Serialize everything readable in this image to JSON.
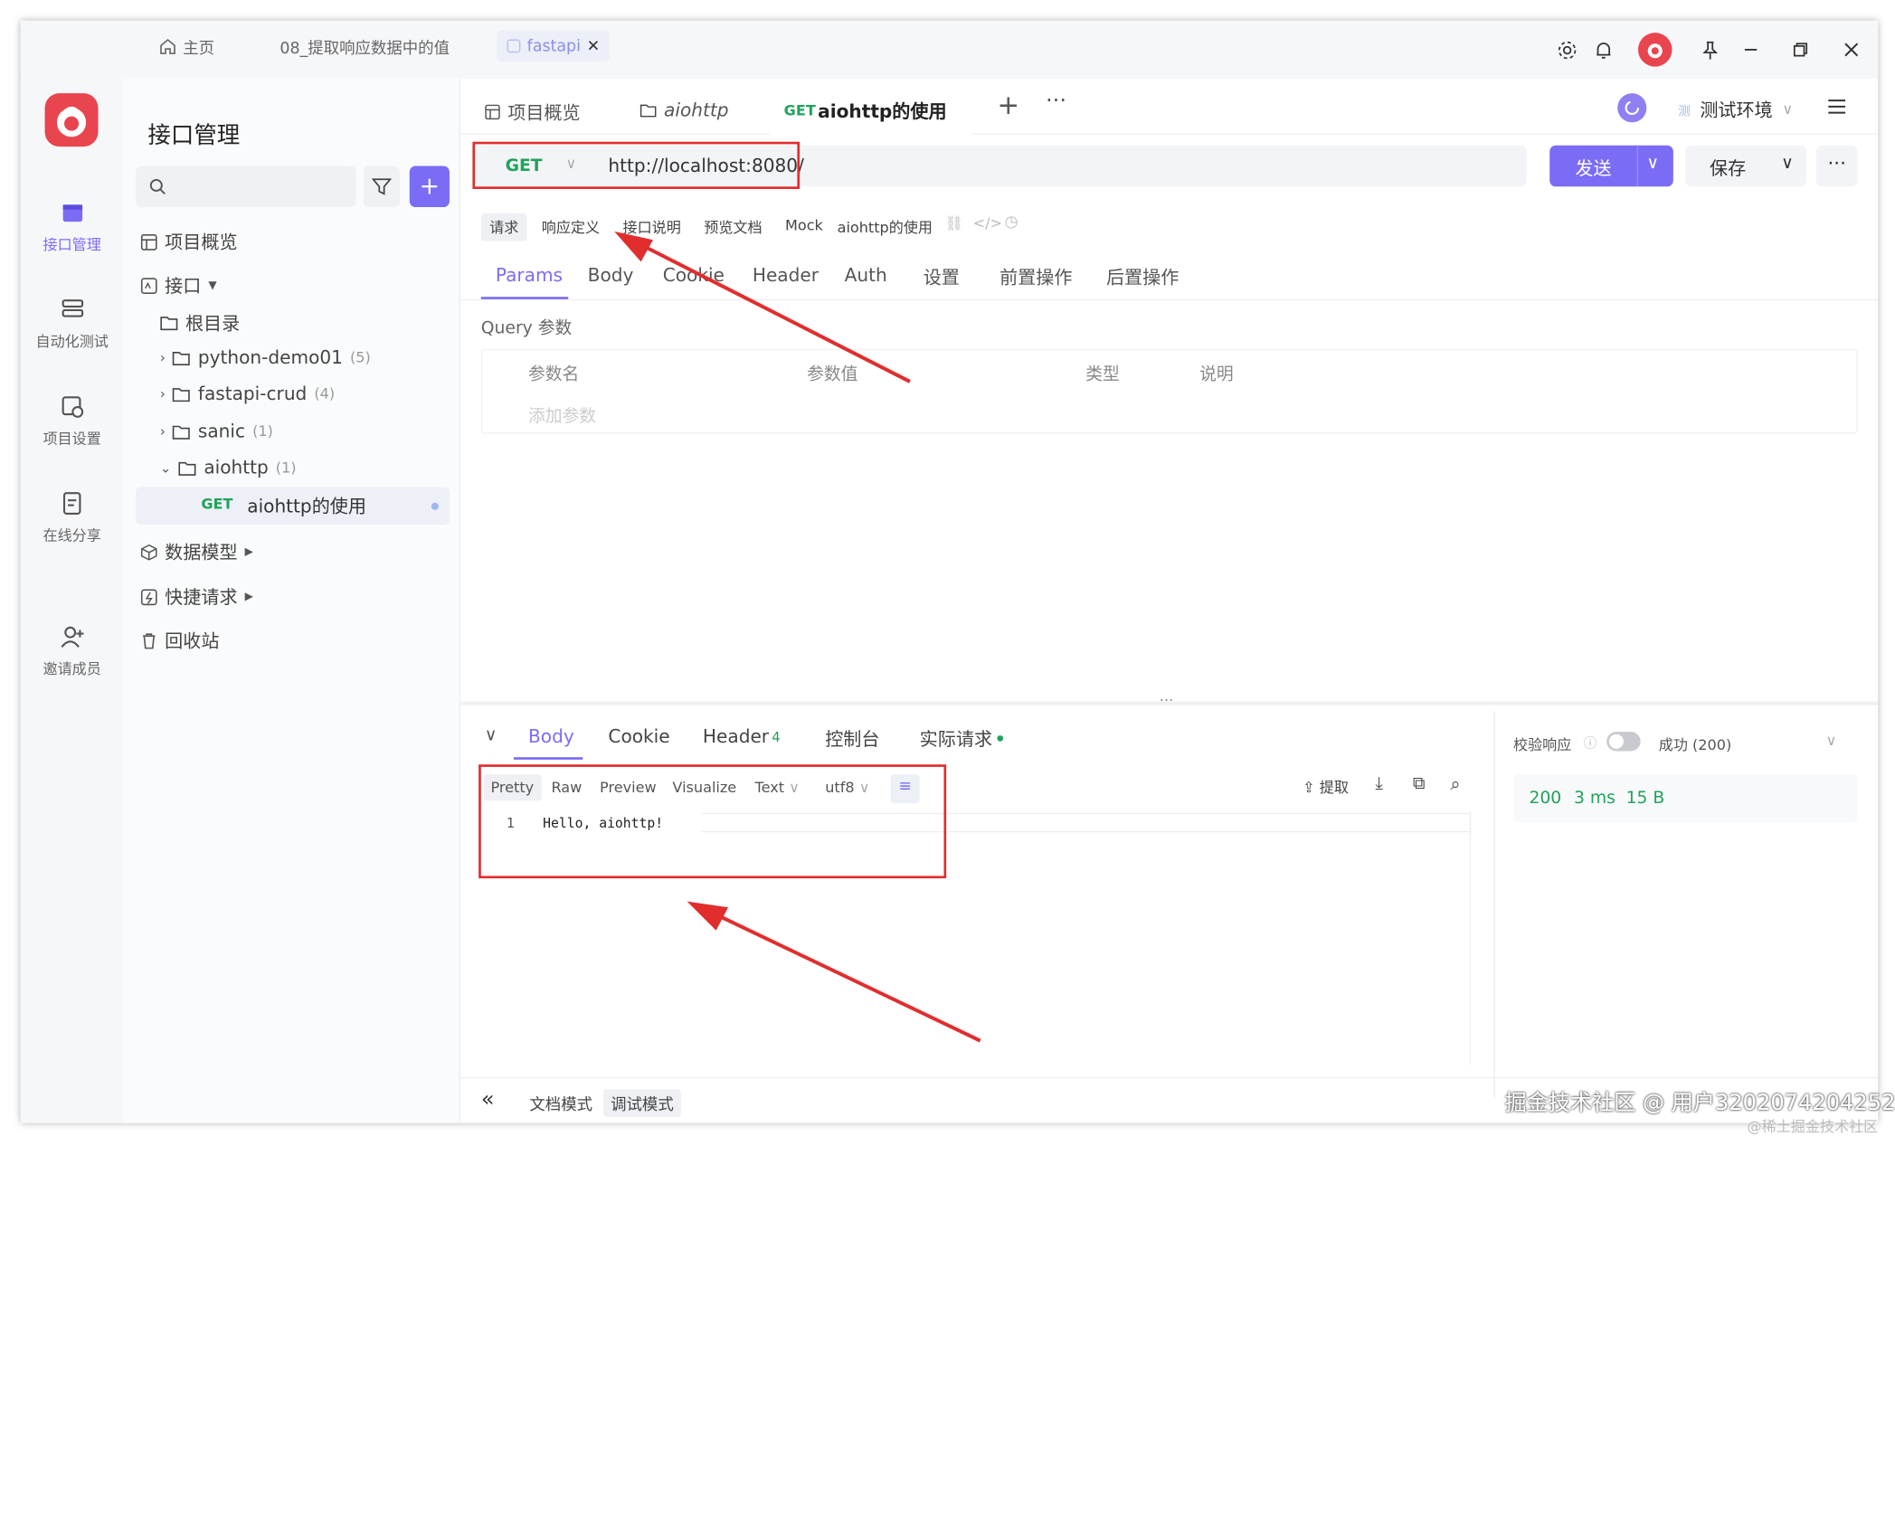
{
  "titlebar": {
    "tabs": [
      {
        "label": "主页"
      },
      {
        "label": "08_提取响应数据中的值"
      },
      {
        "label": "fastapi"
      }
    ]
  },
  "rail": {
    "items": [
      {
        "label": "接口管理",
        "icon": "api-icon"
      },
      {
        "label": "自动化测试",
        "icon": "automation-icon"
      },
      {
        "label": "项目设置",
        "icon": "settings-icon"
      },
      {
        "label": "在线分享",
        "icon": "share-icon"
      },
      {
        "label": "邀请成员",
        "icon": "invite-icon"
      }
    ]
  },
  "sidebar": {
    "title": "接口管理",
    "search_placeholder": "",
    "items": {
      "overview": "项目概览",
      "api": "接口",
      "root": "根目录",
      "folders": [
        {
          "name": "python-demo01",
          "count": "(5)"
        },
        {
          "name": "fastapi-crud",
          "count": "(4)"
        },
        {
          "name": "sanic",
          "count": "(1)"
        },
        {
          "name": "aiohttp",
          "count": "(1)"
        }
      ],
      "endpoint_method": "GET",
      "endpoint_name": "aiohttp的使用",
      "data_models": "数据模型",
      "quick_request": "快捷请求",
      "recycle": "回收站"
    }
  },
  "main": {
    "tabs": [
      {
        "label": "项目概览"
      },
      {
        "label": "aiohttp"
      },
      {
        "method": "GET",
        "label": "aiohttp的使用"
      }
    ],
    "env": "测试环境",
    "request": {
      "method": "GET",
      "url": "http://localhost:8080/",
      "send": "发送",
      "save": "保存"
    },
    "subtabs": [
      "请求",
      "响应定义",
      "接口说明",
      "预览文档",
      "Mock"
    ],
    "api_name": "aiohttp的使用",
    "param_tabs": [
      "Params",
      "Body",
      "Cookie",
      "Header",
      "Auth",
      "设置",
      "前置操作",
      "后置操作"
    ],
    "query_label": "Query 参数",
    "columns": [
      "参数名",
      "参数值",
      "类型",
      "说明"
    ],
    "add_param": "添加参数"
  },
  "response": {
    "tabs": [
      "Body",
      "Cookie",
      "Header",
      "控制台",
      "实际请求"
    ],
    "header_count": "4",
    "formats": [
      "Pretty",
      "Raw",
      "Preview",
      "Visualize"
    ],
    "type": "Text",
    "encoding": "utf8",
    "extract": "提取",
    "line_no": "1",
    "body_text": "Hello, aiohttp!",
    "verify_label": "校验响应",
    "verify_status": "成功 (200)",
    "status": "200",
    "time": "3 ms",
    "size": "15 B"
  },
  "footer": {
    "doc_mode": "文档模式",
    "debug_mode": "调试模式"
  },
  "watermark": {
    "main": "掘金技术社区 @ 用户3202074204252",
    "sub": "@稀土掘金技术社区"
  },
  "colors": {
    "accent": "#7b6cf6",
    "get": "#20a35a",
    "annotation": "#e22d2d"
  }
}
